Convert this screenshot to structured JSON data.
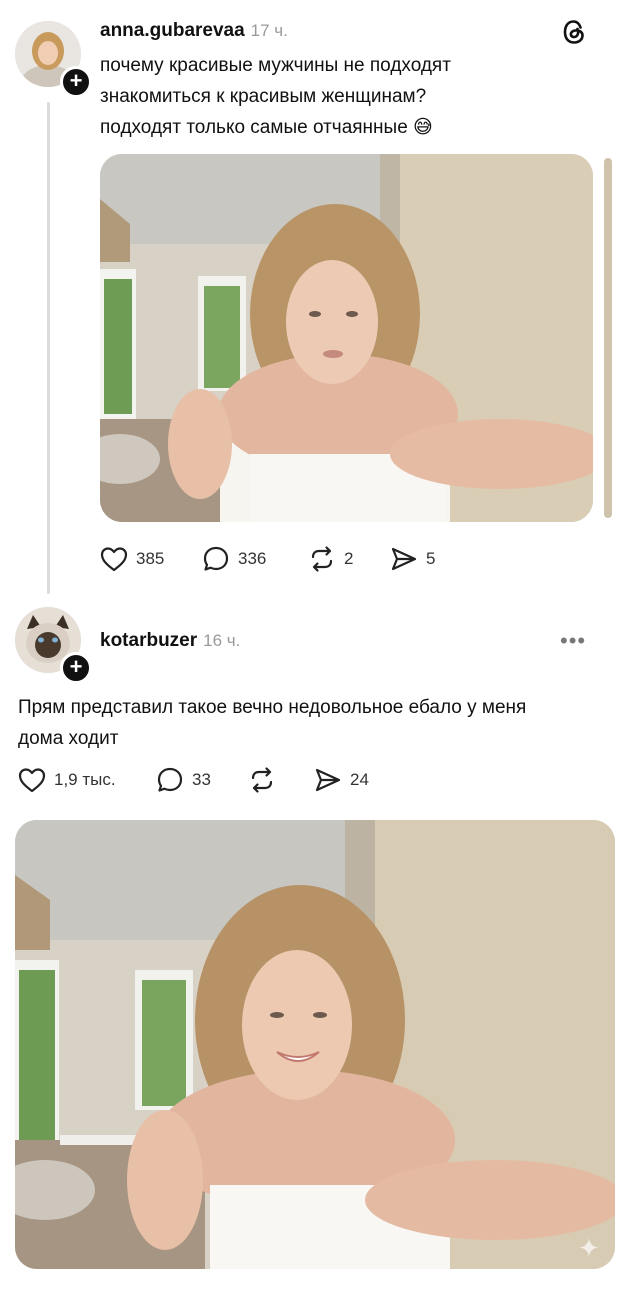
{
  "post": {
    "username": "anna.gubarevaa",
    "time": "17 ч.",
    "lines": [
      "почему красивые мужчины не подходят",
      "знакомиться  к красивым женщинам?",
      "подходят только самые отчаянные"
    ],
    "emoji": "😅",
    "actions": {
      "likes": "385",
      "comments": "336",
      "reposts": "2",
      "shares": "5"
    }
  },
  "reply": {
    "username": "kotarbuzer",
    "time": "16 ч.",
    "more_label": "•••",
    "lines": [
      "Прям представил такое вечно недовольное ебало у меня",
      "дома ходит"
    ],
    "actions": {
      "likes": "1,9 тыс.",
      "comments": "33",
      "shares": "24"
    }
  },
  "icons": {
    "threads_logo": "threads-logo-icon",
    "plus": "+",
    "sparkle": "✦"
  },
  "colors": {
    "text": "#111111",
    "muted": "#999999",
    "line": "#dcdcdc"
  }
}
